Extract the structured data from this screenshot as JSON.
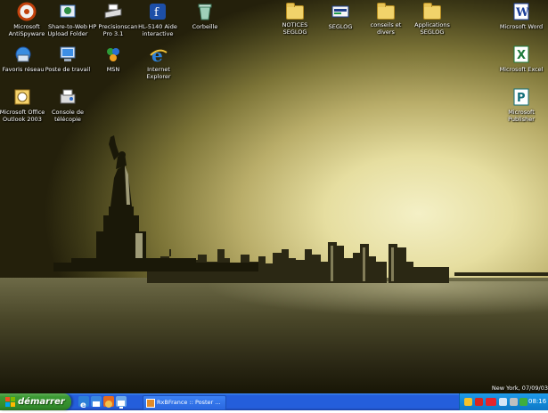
{
  "desktop_icons": [
    {
      "name": "icon-microsoft-antispyware",
      "label": "Microsoft\nAntiSpyware",
      "icon": "antispyware-icon"
    },
    {
      "name": "icon-share-to-web",
      "label": "Share-to-Web\nUpload Folder",
      "icon": "share-to-web-icon"
    },
    {
      "name": "icon-hp-precisionscan",
      "label": "HP Precisionscan\nPro 3.1",
      "icon": "scanner-icon"
    },
    {
      "name": "icon-hl5140-aide",
      "label": "HL-5140 Aide\ninteractive",
      "icon": "printer-help-icon"
    },
    {
      "name": "icon-corbeille",
      "label": "Corbeille",
      "icon": "recycle-bin-icon"
    },
    {
      "name": "icon-notices-seglog",
      "label": "NOTICES\nSEGLOG",
      "icon": "folder-icon"
    },
    {
      "name": "icon-seglog",
      "label": "SEGLOG",
      "icon": "seglog-icon"
    },
    {
      "name": "icon-conseils",
      "label": "conseils et\ndivers",
      "icon": "folder-icon"
    },
    {
      "name": "icon-applications-seglog",
      "label": "Applications\nSEGLOG",
      "icon": "folder-icon"
    },
    {
      "name": "icon-microsoft-word",
      "label": "Microsoft Word",
      "icon": "word-icon"
    },
    {
      "name": "icon-favoris-reseau",
      "label": "Favoris réseau",
      "icon": "network-places-icon"
    },
    {
      "name": "icon-poste-de-travail",
      "label": "Poste de travail",
      "icon": "my-computer-icon"
    },
    {
      "name": "icon-msn",
      "label": "MSN",
      "icon": "msn-icon"
    },
    {
      "name": "icon-internet-explorer",
      "label": "Internet\nExplorer",
      "icon": "internet-explorer-icon"
    },
    {
      "name": "icon-microsoft-excel",
      "label": "Microsoft Excel",
      "icon": "excel-icon"
    },
    {
      "name": "icon-outlook-2003",
      "label": "Microsoft Office\nOutlook 2003",
      "icon": "outlook-icon"
    },
    {
      "name": "icon-console-telecopie",
      "label": "Console de\ntélécopie",
      "icon": "fax-console-icon"
    },
    {
      "name": "icon-microsoft-publisher",
      "label": "Microsoft\nPublisher",
      "icon": "publisher-icon"
    }
  ],
  "wallpaper": {
    "caption": "New York, 07/09/03"
  },
  "taskbar": {
    "start_label": "démarrer",
    "quick_launch": [
      "internet-explorer-icon",
      "outlook-express-icon",
      "firefox-icon",
      "desktop-icon"
    ],
    "active_task": {
      "label": "RxBFrance :: Poster ...",
      "icon": "browser-icon"
    },
    "tray": {
      "icons": [
        "security-icon",
        "antivirus-icon",
        "ati-icon",
        "network-icon",
        "volume-icon",
        "msn-tray-icon"
      ],
      "clock": "08:16"
    }
  },
  "colors": {
    "taskbar": "#245edb",
    "start": "#3c9a34",
    "tray": "#1289d7"
  }
}
